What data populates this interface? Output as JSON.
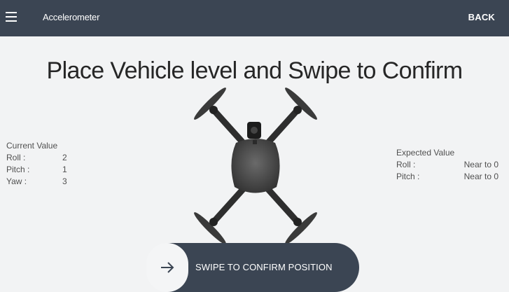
{
  "app_bar": {
    "menu_icon": "hamburger-menu-icon",
    "title": "Accelerometer",
    "back_label": "BACK"
  },
  "instruction": "Place Vehicle level and Swipe to Confirm",
  "current": {
    "heading": "Current Value",
    "rows": [
      {
        "label": "Roll :",
        "value": "2"
      },
      {
        "label": "Pitch :",
        "value": "1"
      },
      {
        "label": "Yaw :",
        "value": "3"
      }
    ]
  },
  "expected": {
    "heading": "Expected Value",
    "rows": [
      {
        "label": "Roll :",
        "value": "Near to 0"
      },
      {
        "label": "Pitch :",
        "value": "Near to 0"
      }
    ]
  },
  "swipe": {
    "label": "SWIPE TO CONFIRM POSITION",
    "icon": "arrow-right-icon"
  },
  "colors": {
    "app_bar": "#3b4553",
    "background": "#f2f3f4",
    "swipe_track": "#3b4553",
    "drone": "#3c3c3c"
  }
}
